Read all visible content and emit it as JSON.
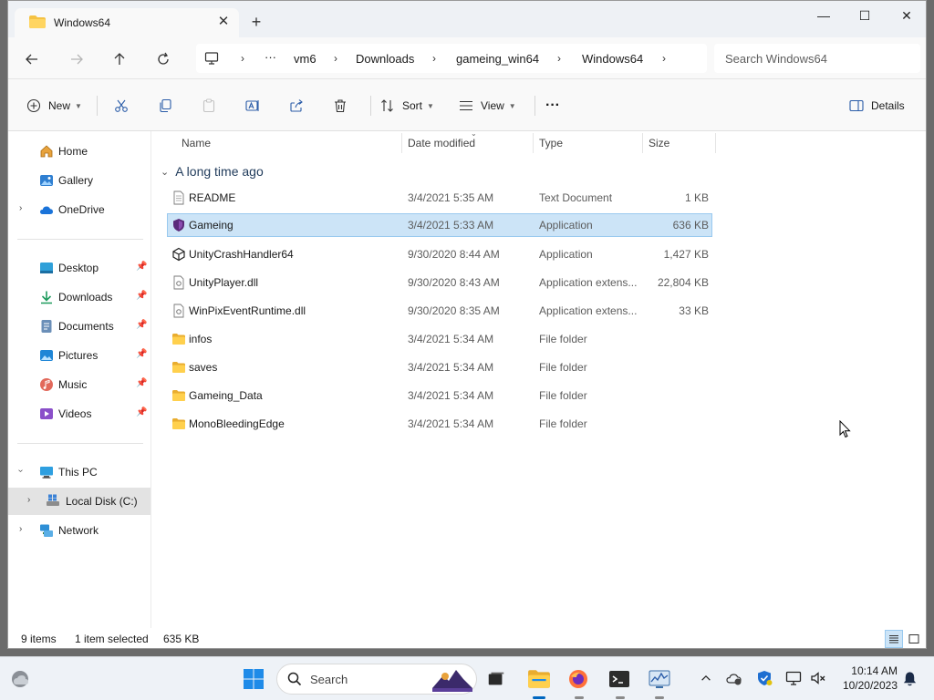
{
  "tab": {
    "title": "Windows64",
    "close_glyph": "✕",
    "new_glyph": "+"
  },
  "window_controls": {
    "minimize": "—",
    "maximize": "☐",
    "close": "✕"
  },
  "breadcrumb": {
    "ellipsis": "···",
    "items": [
      "vm6",
      "Downloads",
      "gameing_win64",
      "Windows64"
    ],
    "separator": "›"
  },
  "search": {
    "placeholder": "Search Windows64"
  },
  "toolbar": {
    "new_label": "New",
    "sort_label": "Sort",
    "view_label": "View",
    "more_glyph": "···",
    "details_label": "Details"
  },
  "sidebar": {
    "items": [
      {
        "label": "Home",
        "icon": "home-icon"
      },
      {
        "label": "Gallery",
        "icon": "gallery-icon"
      },
      {
        "label": "OneDrive",
        "icon": "cloud-icon"
      },
      {
        "label": "Desktop",
        "icon": "desktop-icon"
      },
      {
        "label": "Downloads",
        "icon": "download-icon"
      },
      {
        "label": "Documents",
        "icon": "documents-icon"
      },
      {
        "label": "Pictures",
        "icon": "pictures-icon"
      },
      {
        "label": "Music",
        "icon": "music-icon"
      },
      {
        "label": "Videos",
        "icon": "videos-icon"
      },
      {
        "label": "This PC",
        "icon": "pc-icon"
      },
      {
        "label": "Local Disk (C:)",
        "icon": "drive-icon"
      },
      {
        "label": "Network",
        "icon": "network-icon"
      }
    ]
  },
  "columns": {
    "name": "Name",
    "date": "Date modified",
    "type": "Type",
    "size": "Size"
  },
  "group": {
    "label": "A long time ago"
  },
  "files": [
    {
      "name": "README",
      "date": "3/4/2021 5:35 AM",
      "type": "Text Document",
      "size": "1 KB",
      "icon": "text-file-icon"
    },
    {
      "name": "Gameing",
      "date": "3/4/2021 5:33 AM",
      "type": "Application",
      "size": "636 KB",
      "icon": "app-shield-icon",
      "selected": true
    },
    {
      "name": "UnityCrashHandler64",
      "date": "9/30/2020 8:44 AM",
      "type": "Application",
      "size": "1,427 KB",
      "icon": "unity-icon"
    },
    {
      "name": "UnityPlayer.dll",
      "date": "9/30/2020 8:43 AM",
      "type": "Application extens...",
      "size": "22,804 KB",
      "icon": "dll-file-icon"
    },
    {
      "name": "WinPixEventRuntime.dll",
      "date": "9/30/2020 8:35 AM",
      "type": "Application extens...",
      "size": "33 KB",
      "icon": "dll-file-icon"
    },
    {
      "name": "infos",
      "date": "3/4/2021 5:34 AM",
      "type": "File folder",
      "size": "",
      "icon": "folder-icon"
    },
    {
      "name": "saves",
      "date": "3/4/2021 5:34 AM",
      "type": "File folder",
      "size": "",
      "icon": "folder-icon"
    },
    {
      "name": "Gameing_Data",
      "date": "3/4/2021 5:34 AM",
      "type": "File folder",
      "size": "",
      "icon": "folder-icon"
    },
    {
      "name": "MonoBleedingEdge",
      "date": "3/4/2021 5:34 AM",
      "type": "File folder",
      "size": "",
      "icon": "folder-icon"
    }
  ],
  "status": {
    "count": "9 items",
    "selection": "1 item selected",
    "size": "635 KB"
  },
  "taskbar": {
    "search_label": "Search"
  },
  "clock": {
    "time": "10:14 AM",
    "date": "10/20/2023"
  },
  "colors": {
    "accent": "#0067c0",
    "selection": "#cce4f7",
    "folder": "#f5c242"
  }
}
